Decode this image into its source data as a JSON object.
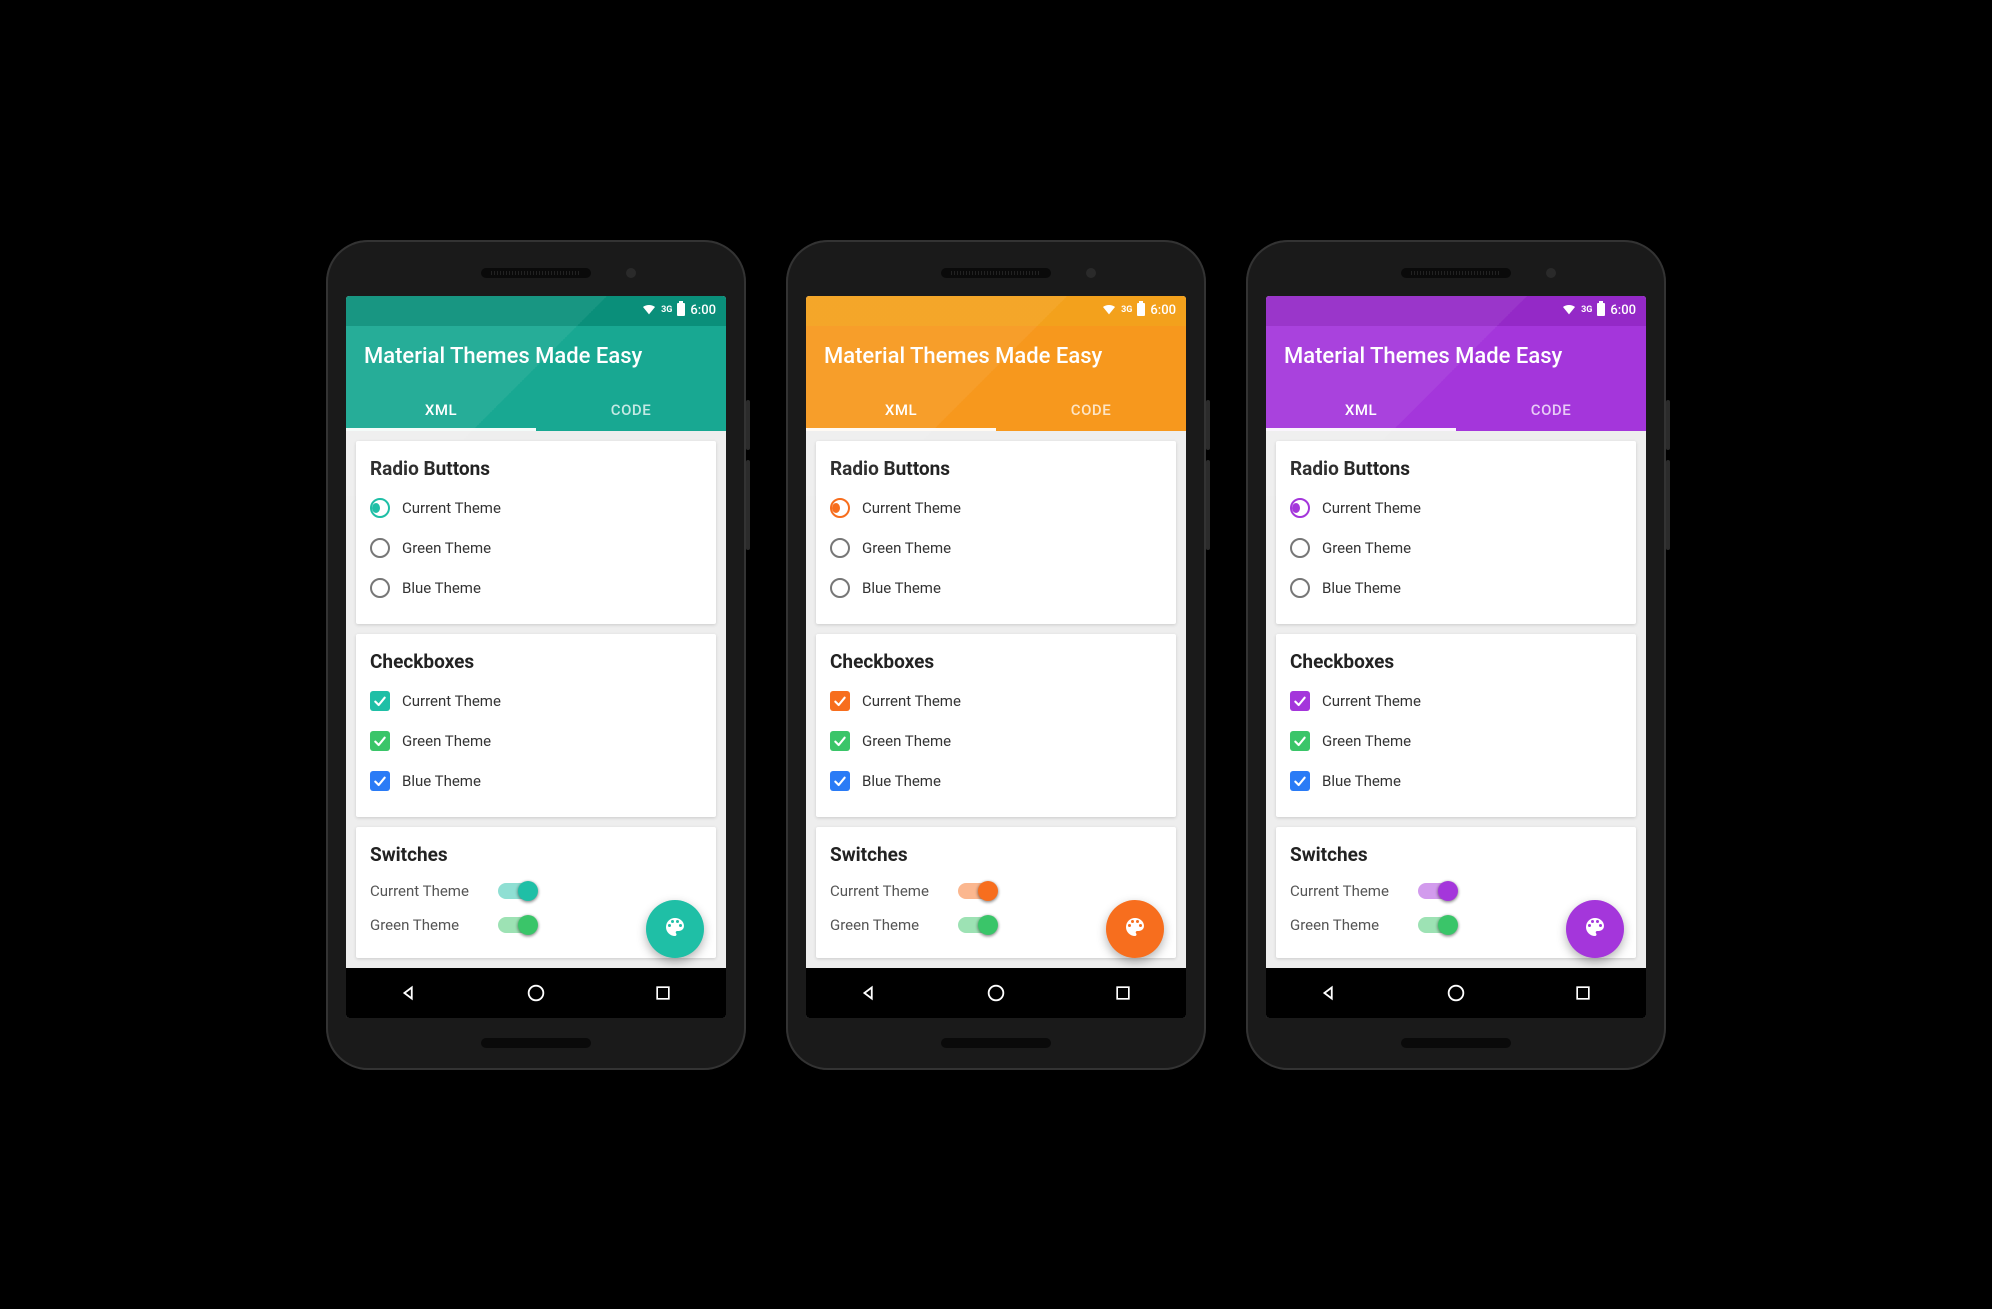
{
  "status": {
    "time": "6:00",
    "network": "3G"
  },
  "app_title": "Material Themes Made Easy",
  "tabs": [
    {
      "label": "XML",
      "active": true
    },
    {
      "label": "CODE",
      "active": false
    }
  ],
  "sections": {
    "radio": {
      "title": "Radio Buttons",
      "options": [
        {
          "label": "Current Theme",
          "checked": true
        },
        {
          "label": "Green Theme",
          "checked": false
        },
        {
          "label": "Blue Theme",
          "checked": false
        }
      ]
    },
    "checkbox": {
      "title": "Checkboxes",
      "options": [
        {
          "label": "Current Theme",
          "checked": true,
          "color_key": "accent"
        },
        {
          "label": "Green Theme",
          "checked": true,
          "color_key": "green"
        },
        {
          "label": "Blue Theme",
          "checked": true,
          "color_key": "blue"
        }
      ]
    },
    "switches": {
      "title": "Switches",
      "options": [
        {
          "label": "Current Theme",
          "on": true,
          "color_key": "accent"
        },
        {
          "label": "Green Theme",
          "on": true,
          "color_key": "green"
        }
      ]
    }
  },
  "shared_palette": {
    "green": "#3ac569",
    "blue": "#2a7bf6"
  },
  "phones": [
    {
      "theme_name": "teal",
      "colors": {
        "status": "#0a8f7a",
        "primary": "#18a892",
        "accent": "#1fbfa6"
      }
    },
    {
      "theme_name": "orange",
      "colors": {
        "status": "#f3a11c",
        "primary": "#f7981d",
        "accent": "#f76e1e"
      }
    },
    {
      "theme_name": "purple",
      "colors": {
        "status": "#9429c7",
        "primary": "#a436db",
        "accent": "#a436db"
      }
    }
  ]
}
